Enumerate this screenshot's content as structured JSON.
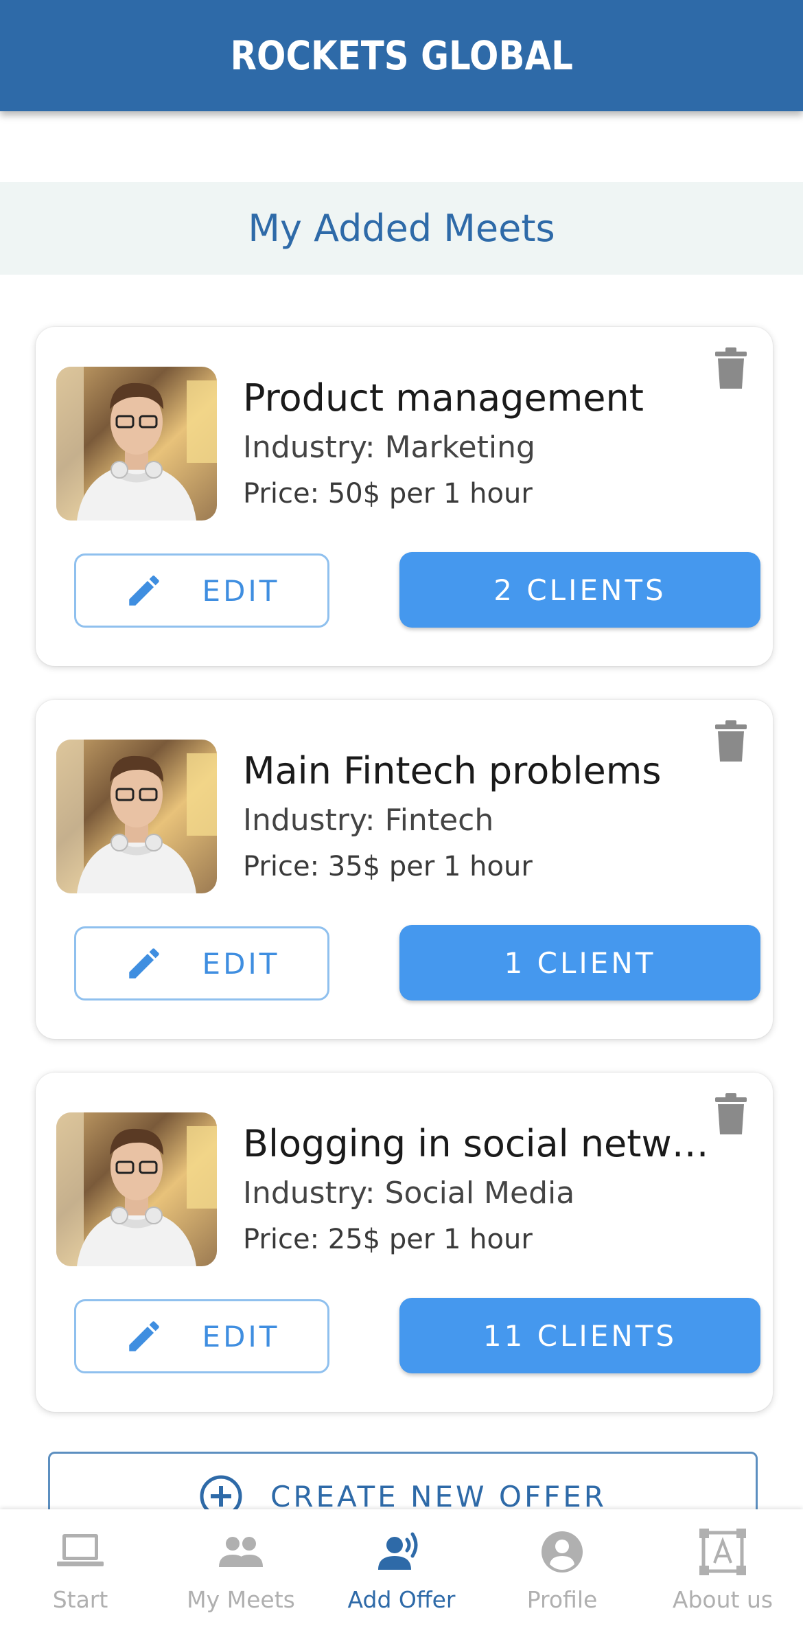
{
  "header": {
    "title": "ROCKETS GLOBAL"
  },
  "section": {
    "title": "My Added Meets"
  },
  "meets": [
    {
      "title": "Product management",
      "industry": "Industry: Marketing",
      "price": "Price: 50$ per 1 hour",
      "edit_label": "EDIT",
      "clients_label": "2 CLIENTS"
    },
    {
      "title": "Main Fintech problems",
      "industry": "Industry: Fintech",
      "price": "Price: 35$ per 1 hour",
      "edit_label": "EDIT",
      "clients_label": "1 CLIENT"
    },
    {
      "title": "Blogging in social netwo...",
      "industry": "Industry: Social Media",
      "price": "Price: 25$ per 1 hour",
      "edit_label": "EDIT",
      "clients_label": "11 CLIENTS"
    }
  ],
  "create_offer": {
    "label": "CREATE NEW OFFER",
    "icon": "plus-circle-icon"
  },
  "bottom_nav": {
    "active": "Add Offer",
    "items": [
      {
        "label": "Start",
        "icon": "laptop-icon"
      },
      {
        "label": "My Meets",
        "icon": "people-icon"
      },
      {
        "label": "Add Offer",
        "icon": "speaker-person-icon"
      },
      {
        "label": "Profile",
        "icon": "account-circle-icon"
      },
      {
        "label": "About us",
        "icon": "text-frame-icon"
      }
    ]
  },
  "colors": {
    "primary": "#2e6aa8",
    "button": "#4598ee",
    "band": "#eff5f4",
    "nav_inactive": "#b0b0b0"
  }
}
